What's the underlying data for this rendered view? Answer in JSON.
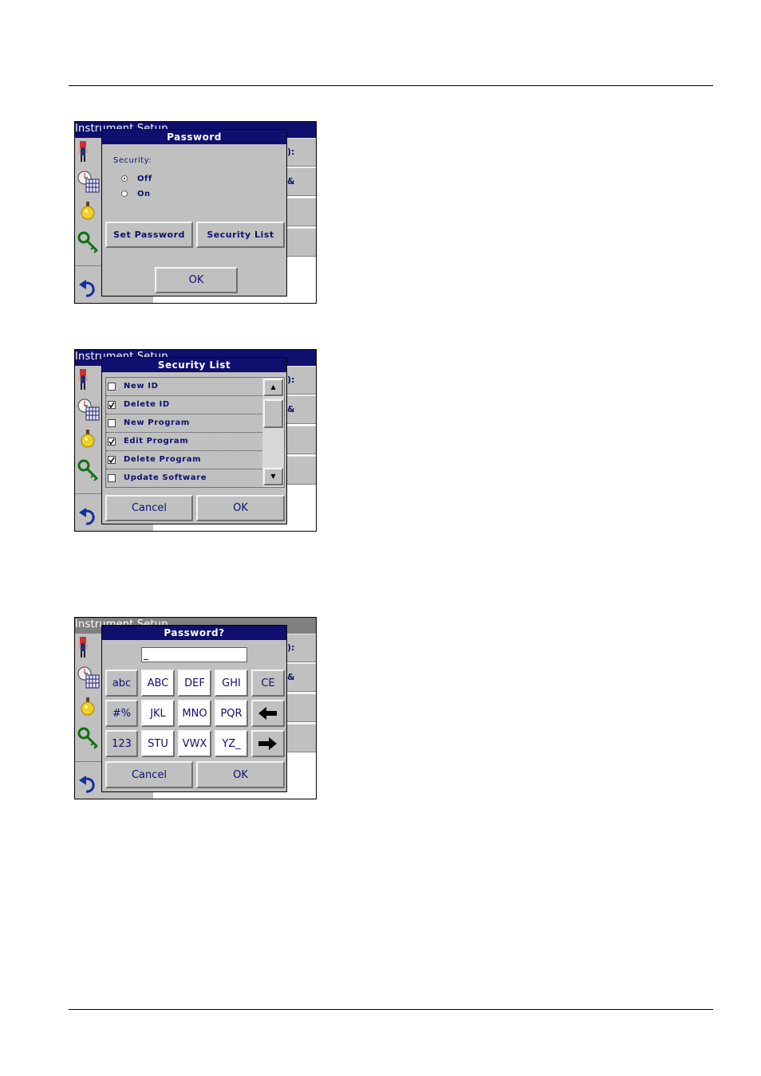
{
  "screen_title": "Instrument Setup",
  "right_partial": {
    "first": "):",
    "second": "&"
  },
  "sidebar": {
    "icons": [
      "operator-id-icon",
      "clock-calendar-icon",
      "lamp-icon",
      "password-key-icon",
      "back-arrow-icon"
    ]
  },
  "password_dialog": {
    "title": "Password",
    "security_label": "Security:",
    "options": [
      {
        "label": "Off",
        "selected": true
      },
      {
        "label": "On",
        "selected": false
      }
    ],
    "set_password_label": "Set Password",
    "security_list_label": "Security List",
    "ok_label": "OK"
  },
  "security_list_dialog": {
    "title": "Security List",
    "items": [
      {
        "label": "New ID",
        "checked": false
      },
      {
        "label": "Delete ID",
        "checked": true
      },
      {
        "label": "New Program",
        "checked": false
      },
      {
        "label": "Edit Program",
        "checked": true
      },
      {
        "label": "Delete Program",
        "checked": true
      },
      {
        "label": "Update Software",
        "checked": false
      }
    ],
    "cancel_label": "Cancel",
    "ok_label": "OK"
  },
  "password_entry_dialog": {
    "title": "Password?",
    "input_value": "_",
    "keys_row1": [
      "abc",
      "ABC",
      "DEF",
      "GHI",
      "CE"
    ],
    "keys_row2": [
      "#%",
      "JKL",
      "MNO",
      "PQR"
    ],
    "keys_row3": [
      "123",
      "STU",
      "VWX",
      "YZ_"
    ],
    "cancel_label": "Cancel",
    "ok_label": "OK"
  },
  "colors": {
    "title_bar": "#0f0f6e",
    "panel": "#c0c0c0",
    "text": "#0f0f6e"
  }
}
